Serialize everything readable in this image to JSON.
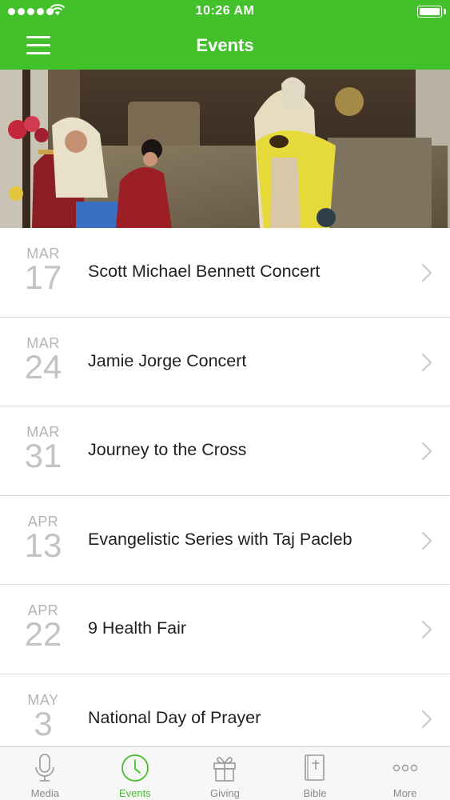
{
  "status_bar": {
    "time": "10:26 AM"
  },
  "header": {
    "title": "Events",
    "menu_icon": "hamburger-menu-icon"
  },
  "hero_image": {
    "description_icon": "nativity-scene-photo"
  },
  "events": [
    {
      "month": "MAR",
      "day": "17",
      "title": "Scott Michael Bennett Concert"
    },
    {
      "month": "MAR",
      "day": "24",
      "title": "Jamie Jorge Concert"
    },
    {
      "month": "MAR",
      "day": "31",
      "title": "Journey to the Cross"
    },
    {
      "month": "APR",
      "day": "13",
      "title": "Evangelistic Series with Taj Pacleb"
    },
    {
      "month": "APR",
      "day": "22",
      "title": "9 Health Fair"
    },
    {
      "month": "MAY",
      "day": "3",
      "title": "National Day of Prayer"
    }
  ],
  "tabs": [
    {
      "label": "Media",
      "icon": "microphone-icon",
      "active": false
    },
    {
      "label": "Events",
      "icon": "clock-icon",
      "active": true
    },
    {
      "label": "Giving",
      "icon": "gift-icon",
      "active": false
    },
    {
      "label": "Bible",
      "icon": "bible-icon",
      "active": false
    },
    {
      "label": "More",
      "icon": "more-dots-icon",
      "active": false
    }
  ],
  "colors": {
    "accent": "#43c12a",
    "text": "#1f1f1f",
    "date": "#b4b4b4"
  }
}
